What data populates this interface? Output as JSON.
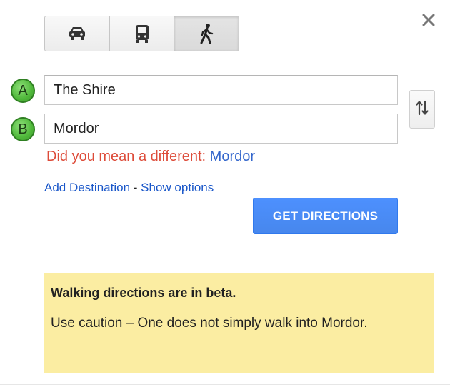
{
  "travel_modes": [
    {
      "icon": "car-icon",
      "active": false
    },
    {
      "icon": "transit-icon",
      "active": false
    },
    {
      "icon": "walking-icon",
      "active": true
    }
  ],
  "close": {
    "icon": "close-icon",
    "glyph": "✕"
  },
  "waypoints": {
    "a": {
      "marker": "A",
      "value": "The Shire"
    },
    "b": {
      "marker": "B",
      "value": "Mordor"
    }
  },
  "swap": {
    "icon": "swap-arrows-icon"
  },
  "suggestion": {
    "label": "Did you mean a different:",
    "link": "Mordor"
  },
  "links": {
    "add_destination": "Add Destination",
    "separator": "-",
    "show_options": "Show options"
  },
  "get_directions": "GET DIRECTIONS",
  "notice": {
    "title": "Walking directions are in beta.",
    "body": "Use caution – One does not simply walk into Mordor."
  },
  "colors": {
    "accent": "#4d90fe",
    "marker": "#4fb83a",
    "warning_text": "#dd4b39",
    "link": "#1a57c9",
    "notice_bg": "#fbeda2"
  }
}
